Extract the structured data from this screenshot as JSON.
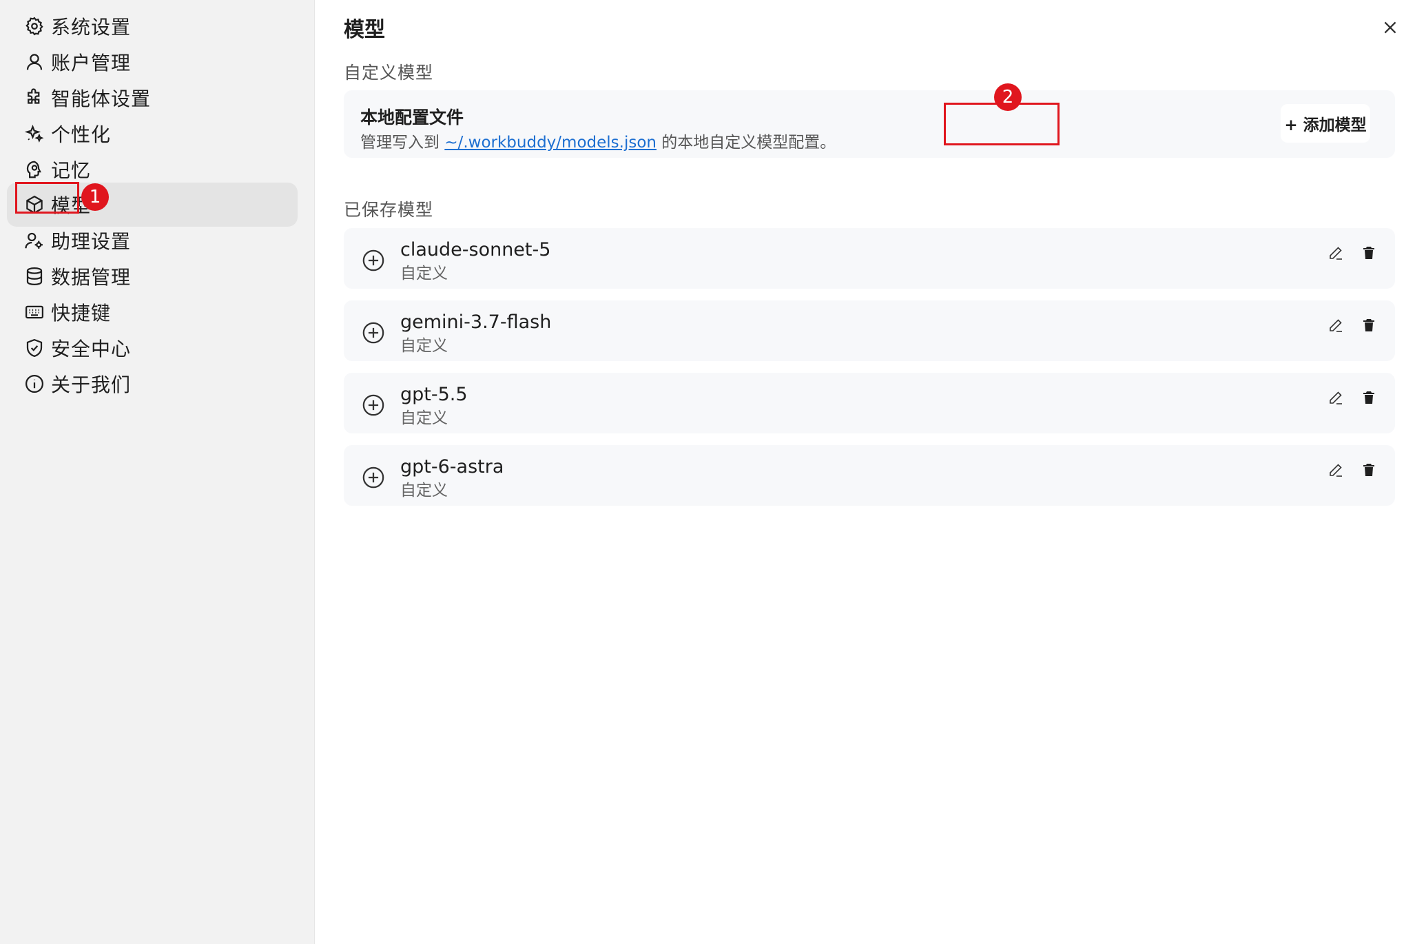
{
  "sidebar": {
    "items": [
      {
        "label": "系统设置",
        "icon": "gear-icon",
        "active": false
      },
      {
        "label": "账户管理",
        "icon": "user-icon",
        "active": false
      },
      {
        "label": "智能体设置",
        "icon": "puzzle-icon",
        "active": false
      },
      {
        "label": "个性化",
        "icon": "sparkle-icon",
        "active": false
      },
      {
        "label": "记忆",
        "icon": "brain-icon",
        "active": false
      },
      {
        "label": "模型",
        "icon": "cube-icon",
        "active": true
      },
      {
        "label": "助理设置",
        "icon": "user-gear-icon",
        "active": false
      },
      {
        "label": "数据管理",
        "icon": "database-icon",
        "active": false
      },
      {
        "label": "快捷键",
        "icon": "keyboard-icon",
        "active": false
      },
      {
        "label": "安全中心",
        "icon": "shield-icon",
        "active": false
      },
      {
        "label": "关于我们",
        "icon": "info-icon",
        "active": false
      }
    ]
  },
  "annotations": {
    "badge1": "1",
    "badge2": "2",
    "color": "#e0161e"
  },
  "main": {
    "title": "模型",
    "custom_section_title": "自定义模型",
    "config": {
      "title": "本地配置文件",
      "desc_prefix": "管理写入到 ",
      "desc_link": "~/.workbuddy/models.json",
      "desc_suffix": " 的本地自定义模型配置。"
    },
    "add_button_label": "+ 添加模型",
    "saved_section_title": "已保存模型",
    "models": [
      {
        "name": "claude-sonnet-5",
        "tag": "自定义"
      },
      {
        "name": "gemini-3.7-flash",
        "tag": "自定义"
      },
      {
        "name": "gpt-5.5",
        "tag": "自定义"
      },
      {
        "name": "gpt-6-astra",
        "tag": "自定义"
      }
    ]
  },
  "colors": {
    "sidebar_bg": "#f2f2f2",
    "active_bg": "#e4e4e4",
    "card_bg": "#f7f8fa",
    "link": "#1d6fd1"
  }
}
